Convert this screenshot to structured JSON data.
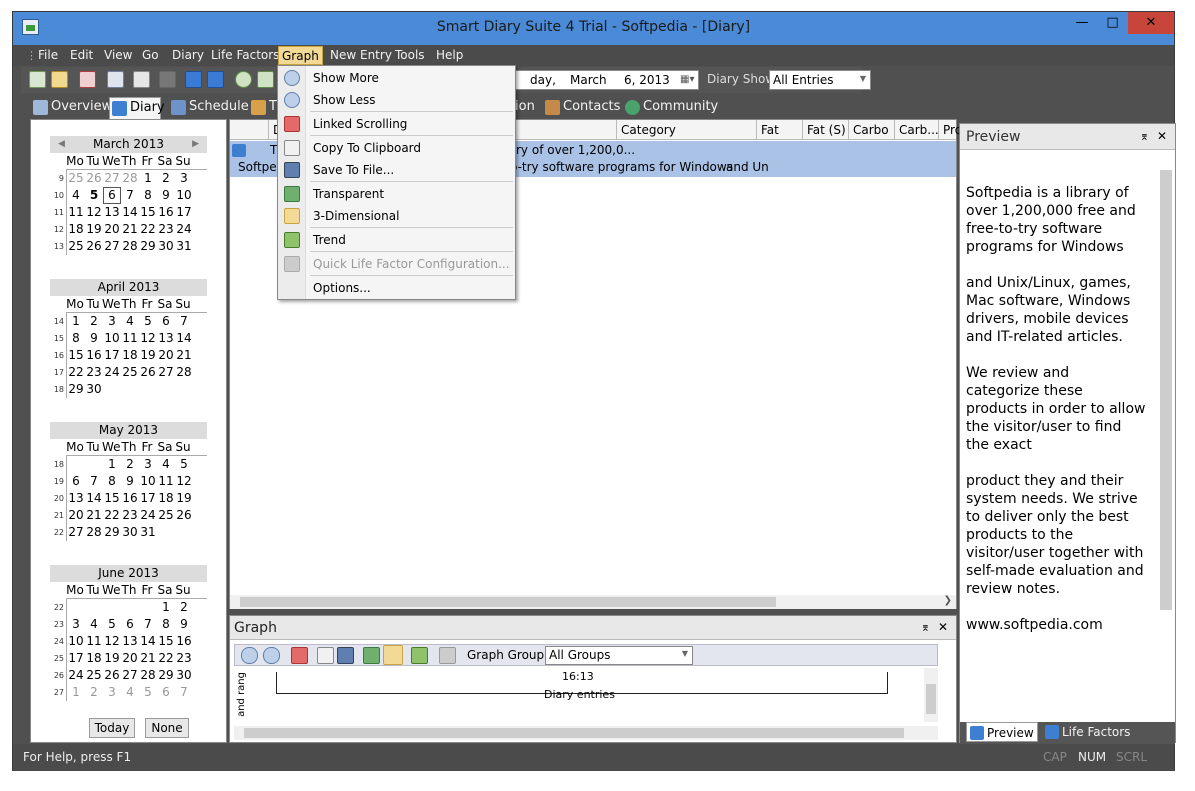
{
  "window": {
    "title": "Smart Diary Suite 4 Trial - Softpedia - [Diary]"
  },
  "menubar": {
    "items": [
      "File",
      "Edit",
      "View",
      "Go",
      "Diary",
      "Life Factors",
      "Graph",
      "New Entry",
      "Tools",
      "Help"
    ],
    "active": "Graph"
  },
  "toolbar": {
    "date_weekday": "day,",
    "date_month": "March",
    "date_day": "6, 2013",
    "diary_show_label": "Diary Show:",
    "diary_show_value": "All Entries"
  },
  "tabs": [
    "Overview",
    "Diary",
    "Schedule",
    "T",
    "ion",
    "Contacts",
    "Community"
  ],
  "calendar": {
    "dow": [
      "Mo",
      "Tu",
      "We",
      "Th",
      "Fr",
      "Sa",
      "Su"
    ],
    "months": [
      {
        "name": "March 2013",
        "rows": [
          {
            "wk": "9",
            "days": [
              "25",
              "26",
              "27",
              "28",
              "1",
              "2",
              "3"
            ]
          },
          {
            "wk": "10",
            "days": [
              "4",
              "5",
              "6",
              "7",
              "8",
              "9",
              "10"
            ]
          },
          {
            "wk": "11",
            "days": [
              "11",
              "12",
              "13",
              "14",
              "15",
              "16",
              "17"
            ]
          },
          {
            "wk": "12",
            "days": [
              "18",
              "19",
              "20",
              "21",
              "22",
              "23",
              "24"
            ]
          },
          {
            "wk": "13",
            "days": [
              "25",
              "26",
              "27",
              "28",
              "29",
              "30",
              "31"
            ]
          }
        ]
      },
      {
        "name": "April 2013",
        "rows": [
          {
            "wk": "14",
            "days": [
              "1",
              "2",
              "3",
              "4",
              "5",
              "6",
              "7"
            ]
          },
          {
            "wk": "15",
            "days": [
              "8",
              "9",
              "10",
              "11",
              "12",
              "13",
              "14"
            ]
          },
          {
            "wk": "16",
            "days": [
              "15",
              "16",
              "17",
              "18",
              "19",
              "20",
              "21"
            ]
          },
          {
            "wk": "17",
            "days": [
              "22",
              "23",
              "24",
              "25",
              "26",
              "27",
              "28"
            ]
          },
          {
            "wk": "18",
            "days": [
              "29",
              "30",
              "",
              "",
              "",
              "",
              ""
            ]
          }
        ]
      },
      {
        "name": "May 2013",
        "rows": [
          {
            "wk": "18",
            "days": [
              "",
              "",
              "1",
              "2",
              "3",
              "4",
              "5"
            ]
          },
          {
            "wk": "19",
            "days": [
              "6",
              "7",
              "8",
              "9",
              "10",
              "11",
              "12"
            ]
          },
          {
            "wk": "20",
            "days": [
              "13",
              "14",
              "15",
              "16",
              "17",
              "18",
              "19"
            ]
          },
          {
            "wk": "21",
            "days": [
              "20",
              "21",
              "22",
              "23",
              "24",
              "25",
              "26"
            ]
          },
          {
            "wk": "22",
            "days": [
              "27",
              "28",
              "29",
              "30",
              "31",
              "",
              ""
            ]
          }
        ]
      },
      {
        "name": "June 2013",
        "rows": [
          {
            "wk": "22",
            "days": [
              "",
              "",
              "",
              "",
              "",
              "1",
              "2"
            ]
          },
          {
            "wk": "23",
            "days": [
              "3",
              "4",
              "5",
              "6",
              "7",
              "8",
              "9"
            ]
          },
          {
            "wk": "24",
            "days": [
              "10",
              "11",
              "12",
              "13",
              "14",
              "15",
              "16"
            ]
          },
          {
            "wk": "25",
            "days": [
              "17",
              "18",
              "19",
              "20",
              "21",
              "22",
              "23"
            ]
          },
          {
            "wk": "26",
            "days": [
              "24",
              "25",
              "26",
              "27",
              "28",
              "29",
              "30"
            ]
          },
          {
            "wk": "27",
            "days": [
              "1",
              "2",
              "3",
              "4",
              "5",
              "6",
              "7"
            ]
          }
        ]
      }
    ],
    "today_button": "Today",
    "none_button": "None"
  },
  "list": {
    "columns": [
      "D",
      "Category",
      "Fat",
      "Fat (S)",
      "Carbo",
      "Carb...",
      "Pro"
    ],
    "row_line1_a": "T",
    "row_line1_b": "ry of over 1,200,0...",
    "row_line2_a": "Softpec",
    "row_line2_b": "o-try software programs for Windows",
    "row_line2_c": "and Un"
  },
  "graph": {
    "title": "Graph",
    "group_label": "Graph Group:",
    "group_value": "All Groups",
    "axis_label": "and rang",
    "time_label": "16:13",
    "caption": "Diary entries"
  },
  "graph_menu": {
    "items": [
      {
        "label": "Show More",
        "icon": "zoom-in-icon",
        "disabled": false
      },
      {
        "label": "Show Less",
        "icon": "zoom-out-icon",
        "disabled": false
      },
      {
        "label": "Linked Scrolling",
        "icon": "pin-icon",
        "disabled": false
      },
      {
        "label": "Copy To Clipboard",
        "icon": "copy-icon",
        "disabled": false
      },
      {
        "label": "Save To File...",
        "icon": "save-icon",
        "disabled": false
      },
      {
        "label": "Transparent",
        "icon": "bar-chart-icon",
        "disabled": false
      },
      {
        "label": "3-Dimensional",
        "icon": "3d-chart-icon",
        "disabled": false
      },
      {
        "label": "Trend",
        "icon": "trend-icon",
        "disabled": false
      },
      {
        "label": "Quick Life Factor Configuration...",
        "icon": "config-icon",
        "disabled": true
      },
      {
        "label": "Options...",
        "icon": "",
        "disabled": false
      }
    ]
  },
  "preview": {
    "title": "Preview",
    "paragraphs": [
      "Softpedia is a library of over 1,200,000 free and free-to-try software programs for Windows",
      "and Unix/Linux, games, Mac software, Windows drivers, mobile devices and IT-related articles.",
      "We review and categorize these products in order to allow the visitor/user to find the exact",
      "product they and their system needs. We strive to deliver only the best products to the visitor/user together with self-made evaluation and review notes.",
      "www.softpedia.com"
    ],
    "tab_preview": "Preview",
    "tab_life_factors": "Life Factors"
  },
  "statusbar": {
    "help": "For Help, press F1",
    "cap": "CAP",
    "num": "NUM",
    "scrl": "SCRL"
  }
}
